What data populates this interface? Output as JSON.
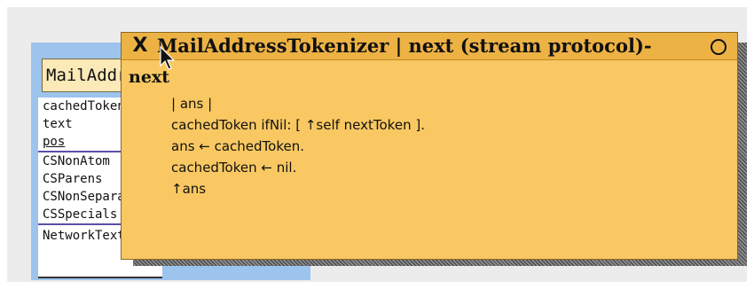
{
  "inspector": {
    "title": "MailAddressTokenizer",
    "fields": [
      {
        "name": "cachedToken",
        "underline": false,
        "separator": false
      },
      {
        "name": "text",
        "underline": false,
        "separator": false
      },
      {
        "name": "pos",
        "underline": true,
        "separator": true
      },
      {
        "name": "CSNonAtom",
        "underline": false,
        "separator": false
      },
      {
        "name": "CSParens",
        "underline": false,
        "separator": false
      },
      {
        "name": "CSNonSeparators",
        "underline": false,
        "separator": false
      },
      {
        "name": "CSSpecials",
        "underline": false,
        "separator": true
      },
      {
        "name": "NetworkTextMessage",
        "underline": false,
        "separator": false
      }
    ]
  },
  "code_window": {
    "close_symbol": "X",
    "title": "MailAddressTokenizer | next (stream protocol)-",
    "collapse_symbol": "O",
    "selector": "next",
    "lines": [
      "| ans |",
      "cachedToken ifNil: [ ↑self nextToken ].",
      "ans ← cachedToken.",
      "cachedToken ← nil.",
      "↑ans"
    ]
  }
}
